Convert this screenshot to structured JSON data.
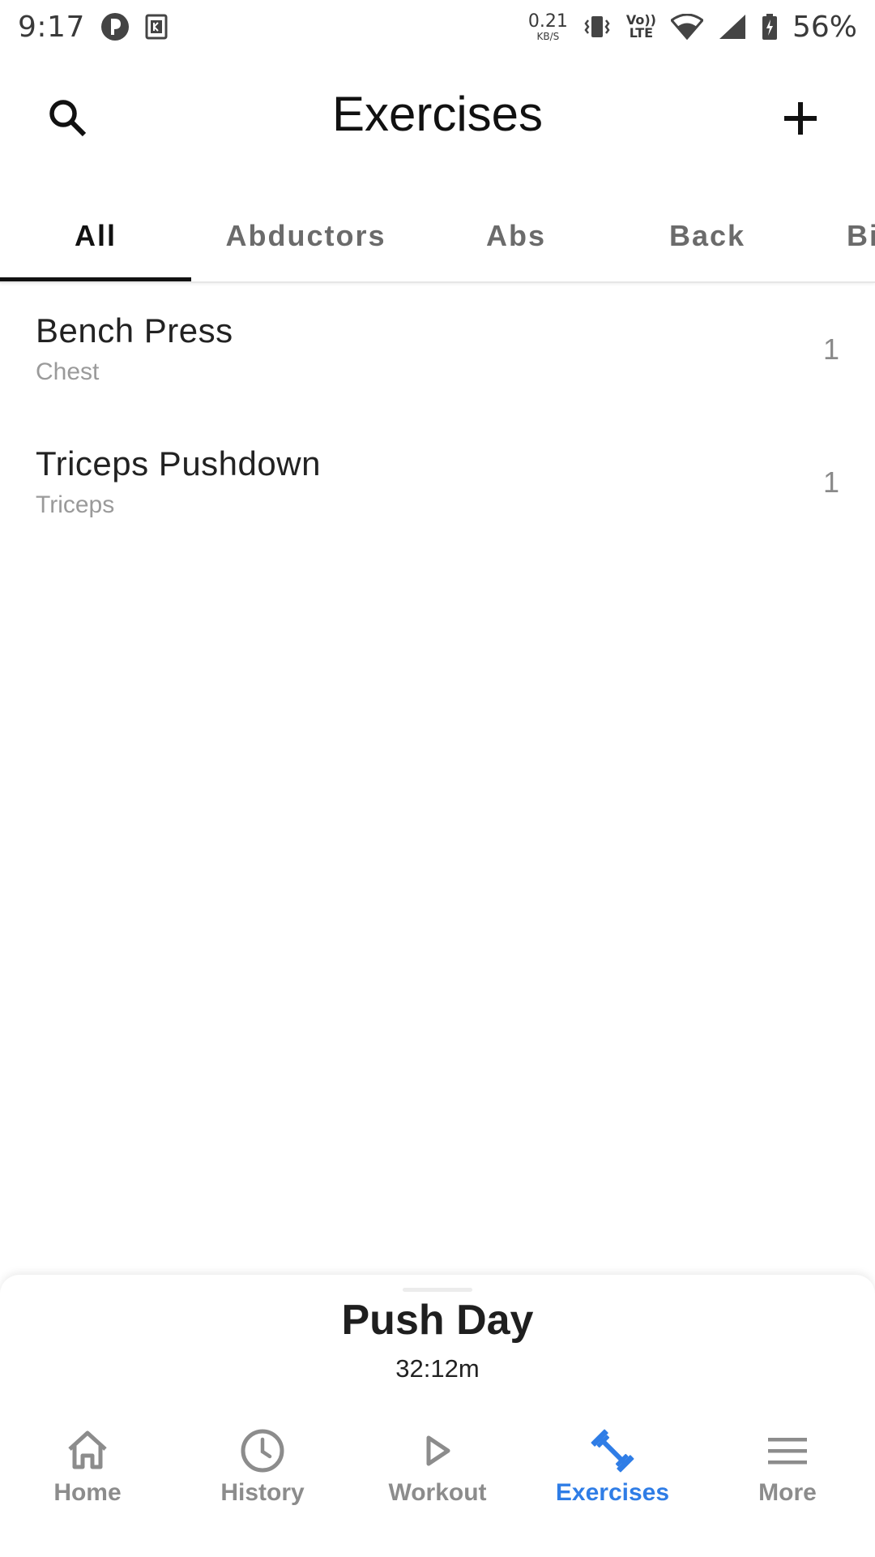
{
  "status_bar": {
    "time": "9:17",
    "net_speed_value": "0.21",
    "net_speed_unit": "KB/S",
    "volte_top": "Vo))",
    "volte_bottom": "LTE",
    "battery_percent": "56%"
  },
  "app_bar": {
    "title": "Exercises",
    "search_icon": "search-icon",
    "add_icon": "plus-icon"
  },
  "tabs": [
    {
      "label": "All",
      "active": true
    },
    {
      "label": "Abductors",
      "active": false
    },
    {
      "label": "Abs",
      "active": false
    },
    {
      "label": "Back",
      "active": false
    },
    {
      "label": "Bi",
      "active": false
    }
  ],
  "exercises": [
    {
      "name": "Bench Press",
      "muscle": "Chest",
      "count": "1"
    },
    {
      "name": "Triceps Pushdown",
      "muscle": "Triceps",
      "count": "1"
    }
  ],
  "active_workout": {
    "name": "Push Day",
    "timer": "32:12m"
  },
  "bottom_nav": [
    {
      "label": "Home",
      "icon": "home-icon",
      "active": false
    },
    {
      "label": "History",
      "icon": "clock-icon",
      "active": false
    },
    {
      "label": "Workout",
      "icon": "play-icon",
      "active": false
    },
    {
      "label": "Exercises",
      "icon": "dumbbell-icon",
      "active": true
    },
    {
      "label": "More",
      "icon": "menu-icon",
      "active": false
    }
  ],
  "colors": {
    "accent": "#2f7de6",
    "inactive": "#8c8c8c",
    "text_primary": "#111111",
    "text_secondary": "#9a9a9a"
  }
}
